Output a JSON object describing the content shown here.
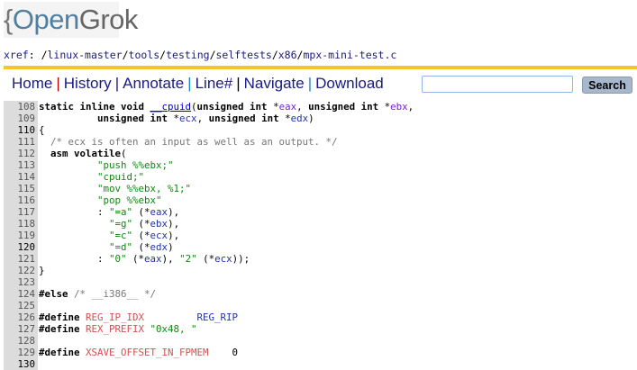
{
  "logo": {
    "brace": "{",
    "open": "Open",
    "grok": "Grok"
  },
  "xref": {
    "label": "xref",
    "colon": ": ",
    "path": [
      {
        "sep": "/",
        "name": "linux-master"
      },
      {
        "sep": "/",
        "name": "tools"
      },
      {
        "sep": "/",
        "name": "testing"
      },
      {
        "sep": "/",
        "name": "selftests"
      },
      {
        "sep": "/",
        "name": "x86"
      },
      {
        "sep": "/",
        "name": "mpx-mini-test.c"
      }
    ]
  },
  "nav": {
    "items": [
      "Home",
      "History",
      "Annotate",
      "Line#",
      "Navigate",
      "Download"
    ],
    "search_value": "",
    "search_button": "Search"
  },
  "code": [
    {
      "n": "108",
      "t": [
        [
          "static inline void ",
          "k"
        ],
        [
          "__cpuid",
          "fn"
        ],
        [
          "(",
          "n"
        ],
        [
          "unsigned int ",
          "k"
        ],
        [
          "*",
          "n"
        ],
        [
          "eax",
          "p"
        ],
        [
          ", ",
          "n"
        ],
        [
          "unsigned int ",
          "k"
        ],
        [
          "*",
          "n"
        ],
        [
          "ebx",
          "p"
        ],
        [
          ",",
          "n"
        ]
      ]
    },
    {
      "n": "109",
      "t": [
        [
          "          ",
          "n"
        ],
        [
          "unsigned int ",
          "k"
        ],
        [
          "*",
          "n"
        ],
        [
          "ecx",
          "v"
        ],
        [
          ", ",
          "n"
        ],
        [
          "unsigned int ",
          "k"
        ],
        [
          "*",
          "n"
        ],
        [
          "edx",
          "v"
        ],
        [
          ")",
          "n"
        ]
      ]
    },
    {
      "n": "110",
      "t": [
        [
          "{",
          "n"
        ]
      ]
    },
    {
      "n": "111",
      "t": [
        [
          "  ",
          "n"
        ],
        [
          "/* ecx is often an input as well as an output. */",
          "c"
        ]
      ]
    },
    {
      "n": "112",
      "t": [
        [
          "  ",
          "n"
        ],
        [
          "asm volatile",
          "k"
        ],
        [
          "(",
          "n"
        ]
      ]
    },
    {
      "n": "113",
      "t": [
        [
          "          ",
          "n"
        ],
        [
          "\"push %%ebx;\"",
          "s"
        ]
      ]
    },
    {
      "n": "114",
      "t": [
        [
          "          ",
          "n"
        ],
        [
          "\"cpuid;\"",
          "s"
        ]
      ]
    },
    {
      "n": "115",
      "t": [
        [
          "          ",
          "n"
        ],
        [
          "\"mov %%ebx, %1;\"",
          "s"
        ]
      ]
    },
    {
      "n": "116",
      "t": [
        [
          "          ",
          "n"
        ],
        [
          "\"pop %%ebx\"",
          "s"
        ]
      ]
    },
    {
      "n": "117",
      "t": [
        [
          "          : ",
          "n"
        ],
        [
          "\"=a\"",
          "s"
        ],
        [
          " (*",
          "n"
        ],
        [
          "eax",
          "v"
        ],
        [
          "),",
          "n"
        ]
      ]
    },
    {
      "n": "118",
      "t": [
        [
          "            ",
          "n"
        ],
        [
          "\"=g\"",
          "s"
        ],
        [
          " (*",
          "n"
        ],
        [
          "ebx",
          "v"
        ],
        [
          "),",
          "n"
        ]
      ]
    },
    {
      "n": "119",
      "t": [
        [
          "            ",
          "n"
        ],
        [
          "\"=c\"",
          "s"
        ],
        [
          " (*",
          "n"
        ],
        [
          "ecx",
          "v"
        ],
        [
          "),",
          "n"
        ]
      ]
    },
    {
      "n": "120",
      "t": [
        [
          "            ",
          "n"
        ],
        [
          "\"=d\"",
          "s"
        ],
        [
          " (*",
          "n"
        ],
        [
          "edx",
          "v"
        ],
        [
          ")",
          "n"
        ]
      ]
    },
    {
      "n": "121",
      "t": [
        [
          "          : ",
          "n"
        ],
        [
          "\"0\"",
          "s"
        ],
        [
          " (*",
          "n"
        ],
        [
          "eax",
          "v"
        ],
        [
          "), ",
          "n"
        ],
        [
          "\"2\"",
          "s"
        ],
        [
          " (*",
          "n"
        ],
        [
          "ecx",
          "v"
        ],
        [
          "));",
          "n"
        ]
      ]
    },
    {
      "n": "122",
      "t": [
        [
          "}",
          "n"
        ]
      ]
    },
    {
      "n": "123",
      "t": []
    },
    {
      "n": "124",
      "t": [
        [
          "#else",
          "k"
        ],
        [
          " /* __i386__ */",
          "c"
        ]
      ]
    },
    {
      "n": "125",
      "t": []
    },
    {
      "n": "126",
      "t": [
        [
          "#define ",
          "k"
        ],
        [
          "REG_IP_IDX",
          "m"
        ],
        [
          "         ",
          "n"
        ],
        [
          "REG_RIP",
          "v"
        ]
      ]
    },
    {
      "n": "127",
      "t": [
        [
          "#define ",
          "k"
        ],
        [
          "REX_PREFIX",
          "m"
        ],
        [
          " ",
          "n"
        ],
        [
          "\"0x48, \"",
          "s"
        ]
      ]
    },
    {
      "n": "128",
      "t": []
    },
    {
      "n": "129",
      "t": [
        [
          "#define ",
          "k"
        ],
        [
          "XSAVE_OFFSET_IN_FPMEM",
          "m"
        ],
        [
          "    0",
          "n"
        ]
      ]
    },
    {
      "n": "130",
      "t": []
    }
  ]
}
